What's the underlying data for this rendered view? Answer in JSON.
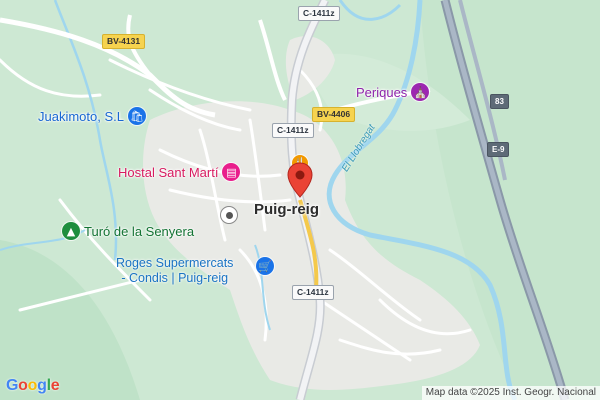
{
  "map": {
    "town": "Puig-reig",
    "river": "El Llobregat",
    "roads": [
      "C-1411z",
      "BV-4131",
      "BV-4406",
      "C-1411z",
      "C-1411z",
      "83",
      "E-9"
    ],
    "pois": [
      {
        "label": "Juakimoto, S.L",
        "icon": "shopping-bag-icon",
        "color": "#1a73e8"
      },
      {
        "label": "Periques",
        "icon": "landmark-icon",
        "color": "#9c27b0"
      },
      {
        "label": "Hostal Sant Martí",
        "icon": "hotel-bed-icon",
        "color": "#e91e8c"
      },
      {
        "label": "Turó de la Senyera",
        "icon": "park-icon",
        "color": "#1e8e3e"
      }
    ],
    "supermarket": {
      "line1": "Roges Supermercats",
      "line2": "- Condis | Puig-reig",
      "icon": "shopping-cart-icon",
      "color": "#1a73e8"
    },
    "marker_icon": "map-pin-icon",
    "restaurant_icon": "restaurant-icon",
    "town_icon": "town-dot-icon"
  },
  "logo": "Google",
  "attribution": "Map data ©2025 Inst. Geogr. Nacional"
}
